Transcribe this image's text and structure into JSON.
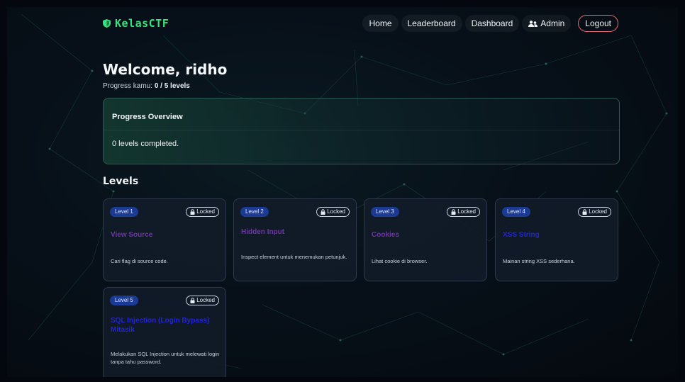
{
  "brand": {
    "name": "KelasCTF",
    "icon": "shield-icon"
  },
  "nav": {
    "home": "Home",
    "leaderboard": "Leaderboard",
    "dashboard": "Dashboard",
    "admin": "Admin",
    "logout": "Logout"
  },
  "welcome": {
    "title": "Welcome, ridho",
    "progress_label": "Progress kamu:",
    "progress_value": "0 / 5 levels"
  },
  "overview": {
    "title": "Progress Overview",
    "text": "0 levels completed.",
    "progress_fraction": 0
  },
  "levels_heading": "Levels",
  "levels": [
    {
      "badge": "Level 1",
      "status": "Locked",
      "title": "View Source",
      "desc": "Cari flag di source code.",
      "title_color": "#6f35a8"
    },
    {
      "badge": "Level 2",
      "status": "Locked",
      "title": "Hidden Input",
      "desc": "Inspect element untuk menemukan petunjuk.",
      "title_color": "#6f35a8"
    },
    {
      "badge": "Level 3",
      "status": "Locked",
      "title": "Cookies",
      "desc": "Lihat cookie di browser.",
      "title_color": "#6f35a8"
    },
    {
      "badge": "Level 4",
      "status": "Locked",
      "title": "XSS String",
      "desc": "Mainan string XSS sederhana.",
      "title_color": "#2323d8"
    },
    {
      "badge": "Level 5",
      "status": "Locked",
      "title": "SQL Injection (Login Bypass) Mitasik",
      "desc": "Melakukan SQL Injection untuk melewati login tanpa tahu password.",
      "title_color": "#2323d8"
    }
  ],
  "colors": {
    "accent": "#36e07a",
    "badge": "#1b3a94",
    "logout_border": "#e36a72"
  }
}
